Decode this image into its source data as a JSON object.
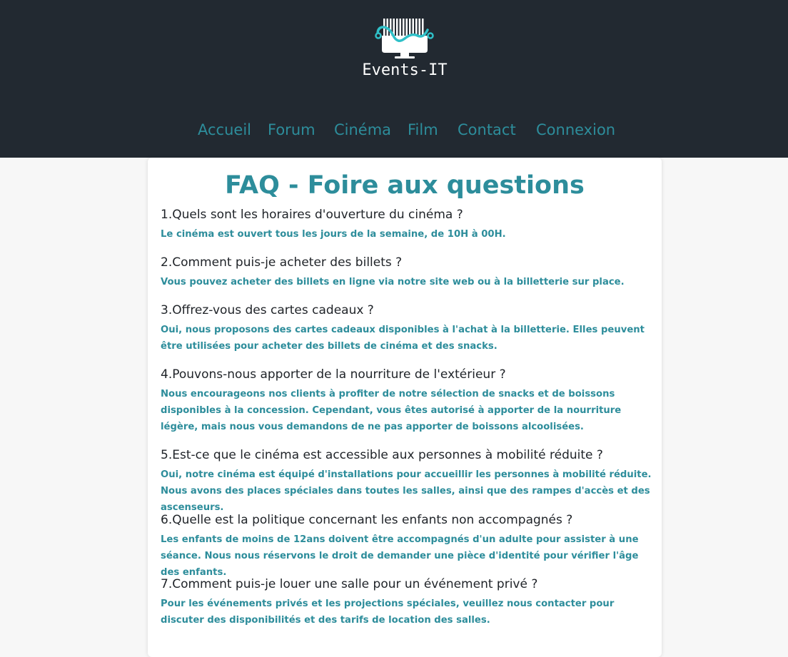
{
  "brand": {
    "logo_text": "Events-IT",
    "accent_color": "#2d8d9b",
    "header_bg": "#222931"
  },
  "nav": {
    "items": [
      {
        "label": "Accueil"
      },
      {
        "label": "Forum"
      },
      {
        "label": "Cinéma"
      },
      {
        "label": "Film"
      },
      {
        "label": "Contact"
      },
      {
        "label": "Connexion"
      }
    ]
  },
  "faq": {
    "title": "FAQ - Foire aux questions",
    "items": [
      {
        "question": "1.Quels sont les horaires d'ouverture du cinéma ?",
        "answer": "Le cinéma est ouvert tous les jours de la semaine, de 10H à 00H."
      },
      {
        "question": "2.Comment puis-je acheter des billets ?",
        "answer": "Vous pouvez acheter des billets en ligne via notre site web ou à la billetterie sur place."
      },
      {
        "question": "3.Offrez-vous des cartes cadeaux ?",
        "answer": "Oui, nous proposons des cartes cadeaux disponibles à l'achat à la billetterie. Elles peuvent être utilisées pour acheter des billets de cinéma et des snacks."
      },
      {
        "question": "4.Pouvons-nous apporter de la nourriture de l'extérieur ?",
        "answer": "Nous encourageons nos clients à profiter de notre sélection de snacks et de boissons disponibles à la concession. Cependant, vous êtes autorisé à apporter de la nourriture légère, mais nous vous demandons de ne pas apporter de boissons alcoolisées."
      },
      {
        "question": "5.Est-ce que le cinéma est accessible aux personnes à mobilité réduite ?",
        "answer": "Oui, notre cinéma est équipé d'installations pour accueillir les personnes à mobilité réduite. Nous avons des places spéciales dans toutes les salles, ainsi que des rampes d'accès et des ascenseurs."
      },
      {
        "question": "6.Quelle est la politique concernant les enfants non accompagnés ?",
        "answer": "Les enfants de moins de 12ans doivent être accompagnés d'un adulte pour assister à une séance. Nous nous réservons le droit de demander une pièce d'identité pour vérifier l'âge des enfants."
      },
      {
        "question": "7.Comment puis-je louer une salle pour un événement privé ?",
        "answer": "Pour les événements privés et les projections spéciales, veuillez nous contacter pour discuter des disponibilités et des tarifs de location des salles."
      }
    ]
  }
}
